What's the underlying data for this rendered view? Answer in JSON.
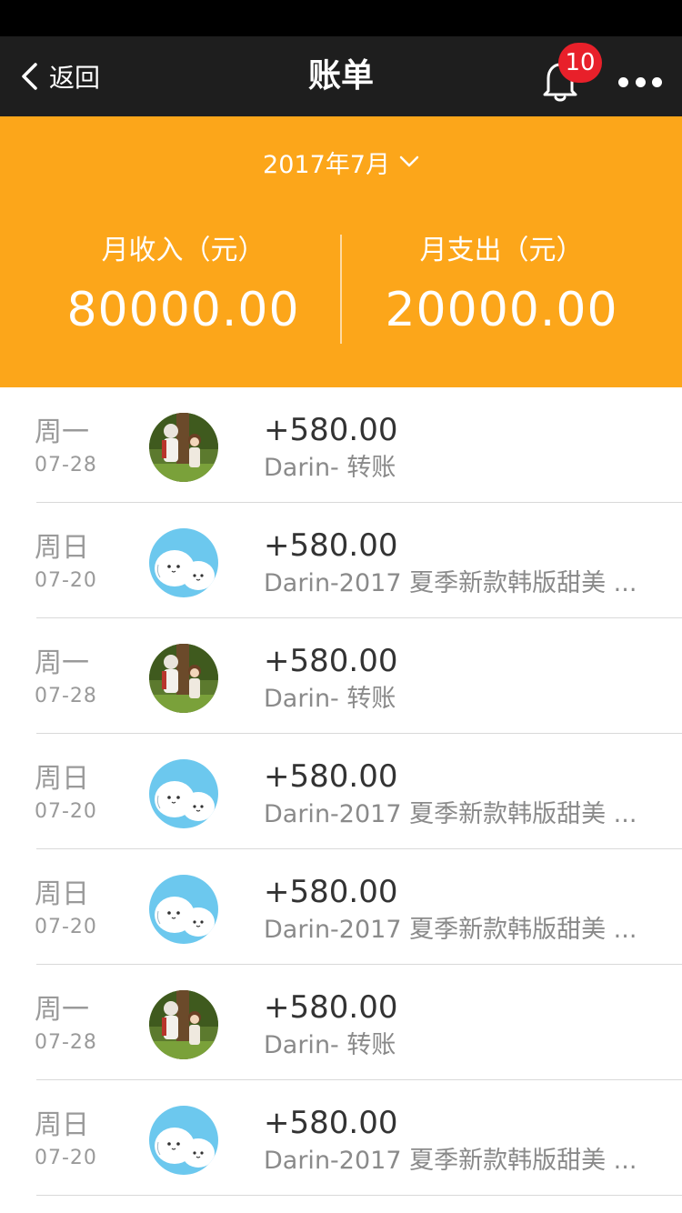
{
  "nav": {
    "back_label": "返回",
    "title": "账单",
    "notification_count": "10"
  },
  "summary": {
    "month": "2017年7月",
    "income_label": "月收入（元）",
    "income_value": "80000.00",
    "expense_label": "月支出（元）",
    "expense_value": "20000.00"
  },
  "transactions": [
    {
      "weekday": "周一",
      "date": "07-28",
      "amount": "+580.00",
      "desc": "Darin- 转账",
      "avatar": "forest-couple-avatar"
    },
    {
      "weekday": "周日",
      "date": "07-20",
      "amount": "+580.00",
      "desc": "Darin-2017 夏季新款韩版甜美 ...",
      "avatar": "marshmallow-avatar"
    },
    {
      "weekday": "周一",
      "date": "07-28",
      "amount": "+580.00",
      "desc": "Darin- 转账",
      "avatar": "forest-couple-avatar"
    },
    {
      "weekday": "周日",
      "date": "07-20",
      "amount": "+580.00",
      "desc": "Darin-2017 夏季新款韩版甜美 ...",
      "avatar": "marshmallow-avatar"
    },
    {
      "weekday": "周日",
      "date": "07-20",
      "amount": "+580.00",
      "desc": "Darin-2017 夏季新款韩版甜美 ...",
      "avatar": "marshmallow-avatar"
    },
    {
      "weekday": "周一",
      "date": "07-28",
      "amount": "+580.00",
      "desc": "Darin- 转账",
      "avatar": "forest-couple-avatar"
    },
    {
      "weekday": "周日",
      "date": "07-20",
      "amount": "+580.00",
      "desc": "Darin-2017 夏季新款韩版甜美 ...",
      "avatar": "marshmallow-avatar"
    }
  ],
  "colors": {
    "nav_bg": "#1e1e1e",
    "summary_bg": "#fca61a",
    "badge": "#e8202a",
    "marshmallow_bg": "#6cc8ee"
  }
}
